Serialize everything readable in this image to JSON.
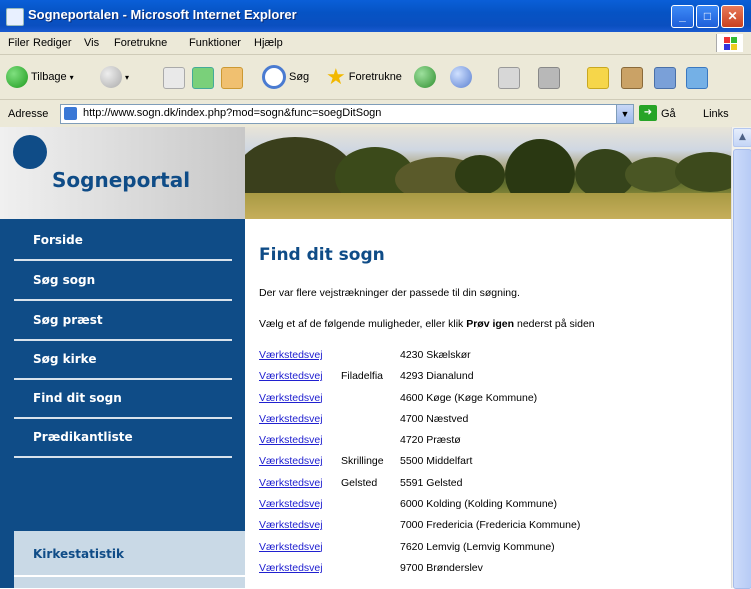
{
  "window": {
    "title": "Sogneportalen - Microsoft Internet Explorer",
    "buttons": {
      "minimize": "_",
      "maximize": "□",
      "close": "✕"
    }
  },
  "menu": [
    "Filer",
    "Rediger",
    "Vis",
    "Foretrukne",
    "Funktioner",
    "Hjælp"
  ],
  "toolbar": {
    "back": "Tilbage",
    "search": "Søg",
    "favorites": "Foretrukne"
  },
  "address": {
    "label": "Adresse",
    "url": "http://www.sogn.dk/index.php?mod=sogn&func=soegDitSogn",
    "go": "Gå",
    "links": "Links"
  },
  "site": {
    "logo_text": "Sogneportal",
    "nav": [
      "Forside",
      "Søg sogn",
      "Søg præst",
      "Søg kirke",
      "Find dit sogn",
      "Prædikantliste"
    ],
    "stat_item": "Kirkestatistik"
  },
  "main": {
    "title": "Find dit sogn",
    "intro1": "Der var flere vejstrækninger der passede til din søgning.",
    "intro2_before": "Vælg et af de følgende muligheder, eller klik ",
    "intro2_bold": "Prøv igen",
    "intro2_after": " nederst på siden",
    "results": [
      {
        "street": "Værkstedsvej",
        "extra": "",
        "postal": "4230 Skælskør"
      },
      {
        "street": "Værkstedsvej",
        "extra": "Filadelfia",
        "postal": "4293 Dianalund"
      },
      {
        "street": "Værkstedsvej",
        "extra": "",
        "postal": "4600 Køge (Køge Kommune)"
      },
      {
        "street": "Værkstedsvej",
        "extra": "",
        "postal": "4700 Næstved"
      },
      {
        "street": "Værkstedsvej",
        "extra": "",
        "postal": "4720 Præstø"
      },
      {
        "street": "Værkstedsvej",
        "extra": "Skrillinge",
        "postal": "5500 Middelfart"
      },
      {
        "street": "Værkstedsvej",
        "extra": "Gelsted",
        "postal": "5591 Gelsted"
      },
      {
        "street": "Værkstedsvej",
        "extra": "",
        "postal": "6000 Kolding (Kolding Kommune)"
      },
      {
        "street": "Værkstedsvej",
        "extra": "",
        "postal": "7000 Fredericia (Fredericia Kommune)"
      },
      {
        "street": "Værkstedsvej",
        "extra": "",
        "postal": "7620 Lemvig (Lemvig Kommune)"
      },
      {
        "street": "Værkstedsvej",
        "extra": "",
        "postal": "9700 Brønderslev"
      }
    ]
  },
  "colors": {
    "brand": "#0f4c87",
    "link": "#2020d0",
    "titlebar": "#0653c4"
  }
}
